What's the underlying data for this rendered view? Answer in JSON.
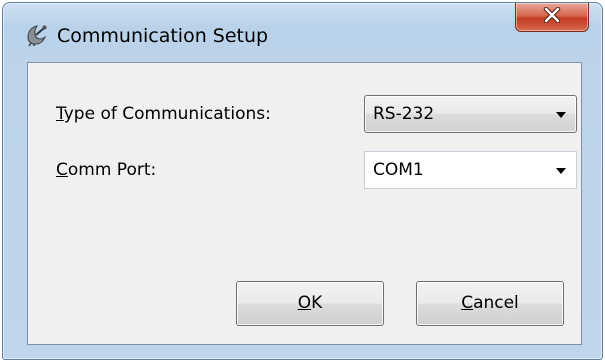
{
  "window": {
    "title": "Communication Setup"
  },
  "form": {
    "type_label_accel": "T",
    "type_label_rest": "ype of Communications:",
    "type_value": "RS-232",
    "port_label_accel": "C",
    "port_label_rest": "omm Port:",
    "port_value": "COM1"
  },
  "buttons": {
    "ok_accel": "O",
    "ok_rest": "K",
    "cancel_accel": "C",
    "cancel_rest": "ancel"
  },
  "icons": {
    "app": "satellite-dish-icon",
    "close": "close-icon",
    "dropdown": "chevron-down-icon"
  },
  "colors": {
    "close_button": "#c8432a",
    "frame": "#bcd3ea",
    "client": "#f0f0f0"
  }
}
